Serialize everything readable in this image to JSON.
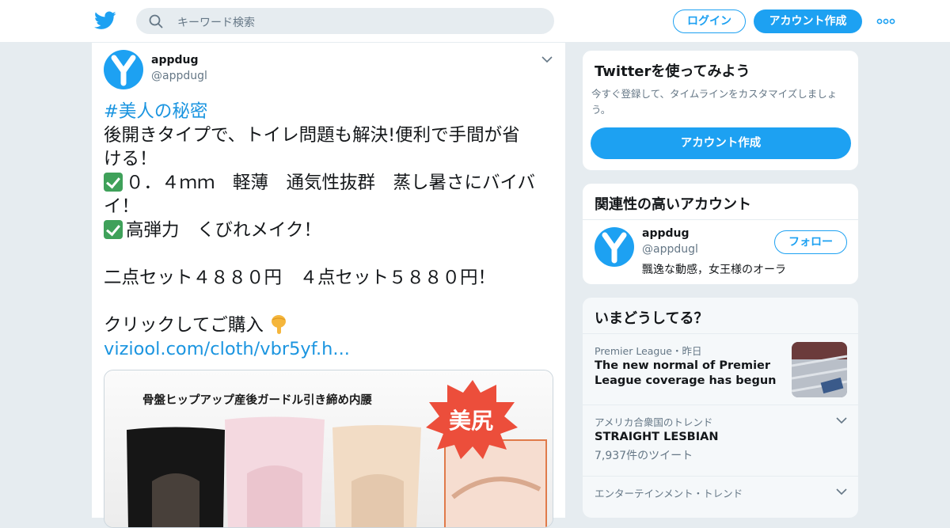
{
  "header": {
    "search_placeholder": "キーワード検索",
    "login_label": "ログイン",
    "signup_label": "アカウント作成",
    "brand_color": "#1da1f2"
  },
  "tweet": {
    "author_name": "appdug",
    "author_handle": "@appdugl",
    "avatar_letter": "Y",
    "hashtag": "#美人の秘密",
    "lines": [
      "後開きタイプで、トイレ問題も解決!便利で手間が省",
      "ける！",
      "０．４ｍｍ　軽薄　通気性抜群　蒸し暑さにバイバ",
      "イ！",
      "高弾力　くびれメイク！",
      "二点セット４８８０円　４点セット５８８０円！",
      "クリックしてご購入"
    ],
    "link": "viziool.com/cloth/vbr5yf.h...",
    "media": {
      "caption": "骨盤ヒップアップ産後ガードル引き締め内腰",
      "badge": "美尻"
    }
  },
  "signup_card": {
    "title": "Twitterを使ってみよう",
    "subtitle": "今すぐ登録して、タイムラインをカスタマイズしましょう。",
    "button_label": "アカウント作成"
  },
  "related_card": {
    "title": "関連性の高いアカウント",
    "account": {
      "name": "appdug",
      "handle": "@appdugl",
      "bio": "飄逸な動感，女王様のオーラ",
      "follow_label": "フォロー"
    }
  },
  "trends_card": {
    "title": "いまどうしてる？",
    "items": [
      {
        "category": "Premier League・昨日",
        "title": "The new normal of Premier League coverage has begun",
        "count": ""
      },
      {
        "category": "アメリカ合衆国のトレンド",
        "title": "STRAIGHT LESBIAN",
        "count": "7,937件のツイート"
      },
      {
        "category": "エンターテインメント・トレンド",
        "title": "",
        "count": ""
      }
    ]
  }
}
